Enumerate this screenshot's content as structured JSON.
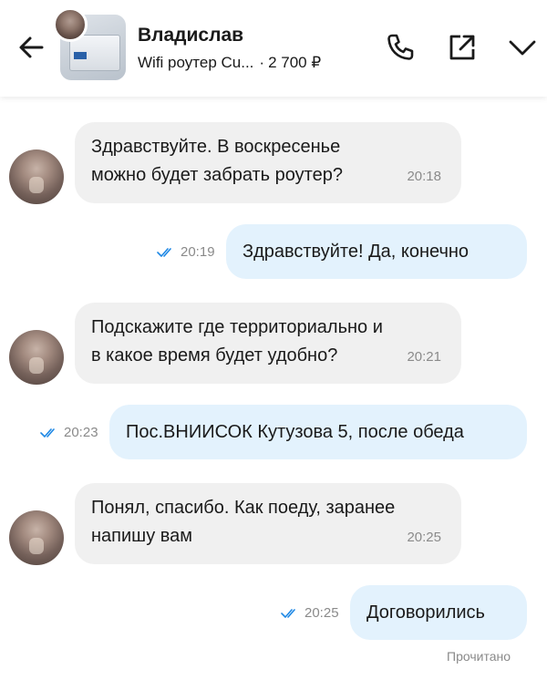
{
  "header": {
    "seller_name": "Владислав",
    "item_title": "Wifi роутер Cu...",
    "separator": "·",
    "item_price": "2 700 ₽"
  },
  "icons": {
    "back": "arrow-left-icon",
    "phone": "phone-icon",
    "share": "share-icon",
    "expand": "chevron-down-icon",
    "read": "double-check-icon"
  },
  "colors": {
    "incoming_bubble": "#f0f0f0",
    "outgoing_bubble": "#e3f2fd",
    "read_check": "#1e88e5",
    "time_text": "#8a8a8a"
  },
  "messages": [
    {
      "direction": "in",
      "lines": [
        "Здравствуйте. В воскресенье",
        "можно будет забрать роутер?"
      ],
      "time": "20:18"
    },
    {
      "direction": "out",
      "text": "Здравствуйте! Да, конечно",
      "time": "20:19"
    },
    {
      "direction": "in",
      "lines": [
        "Подскажите где территориально и",
        "в какое время будет удобно?"
      ],
      "time": "20:21"
    },
    {
      "direction": "out",
      "text": "Пос.ВНИИСОК Кутузова 5, после обеда",
      "time": "20:23"
    },
    {
      "direction": "in",
      "lines": [
        "Понял, спасибо. Как поеду, заранее",
        "напишу вам"
      ],
      "time": "20:25"
    },
    {
      "direction": "out",
      "text": "Договорились",
      "time": "20:25"
    }
  ],
  "read_status": "Прочитано"
}
